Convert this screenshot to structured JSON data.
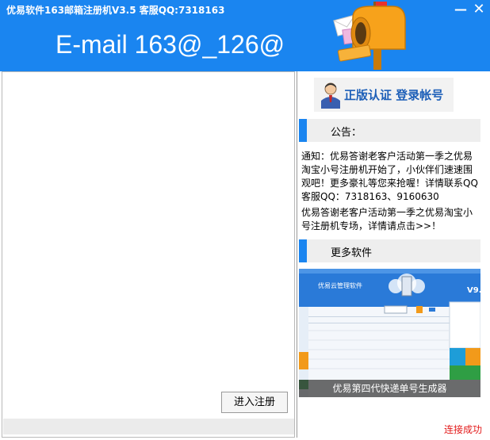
{
  "window": {
    "title": "优易软件163邮箱注册机V3.5   客服QQ:7318163",
    "minimize_glyph": "—",
    "close_glyph": "✕"
  },
  "banner": {
    "text": "E-mail 163@_126@"
  },
  "left": {
    "enter_button_label": "进入注册"
  },
  "right": {
    "login_button_label": "正版认证 登录帐号",
    "announcement_label": "公告：",
    "notice_1": "通知：优易答谢老客户活动第一季之优易淘宝小号注册机开始了，小伙伴们速速围观吧！更多豪礼等您来抢喔！详情联系QQ客服QQ：7318163、9160630",
    "notice_2": "优易答谢老客户活动第一季之优易淘宝小号注册机专场，详情请点击>>！",
    "more_software_label": "更多软件",
    "promo_caption": "优易第四代快递单号生成器",
    "promo_banner_title": "优易云管理软件",
    "promo_version": "V9."
  },
  "status": {
    "text": "连接成功"
  },
  "colors": {
    "titlebar": "#1a85f0",
    "accent_bar": "#1a85f0",
    "status": "#e31a1a"
  }
}
